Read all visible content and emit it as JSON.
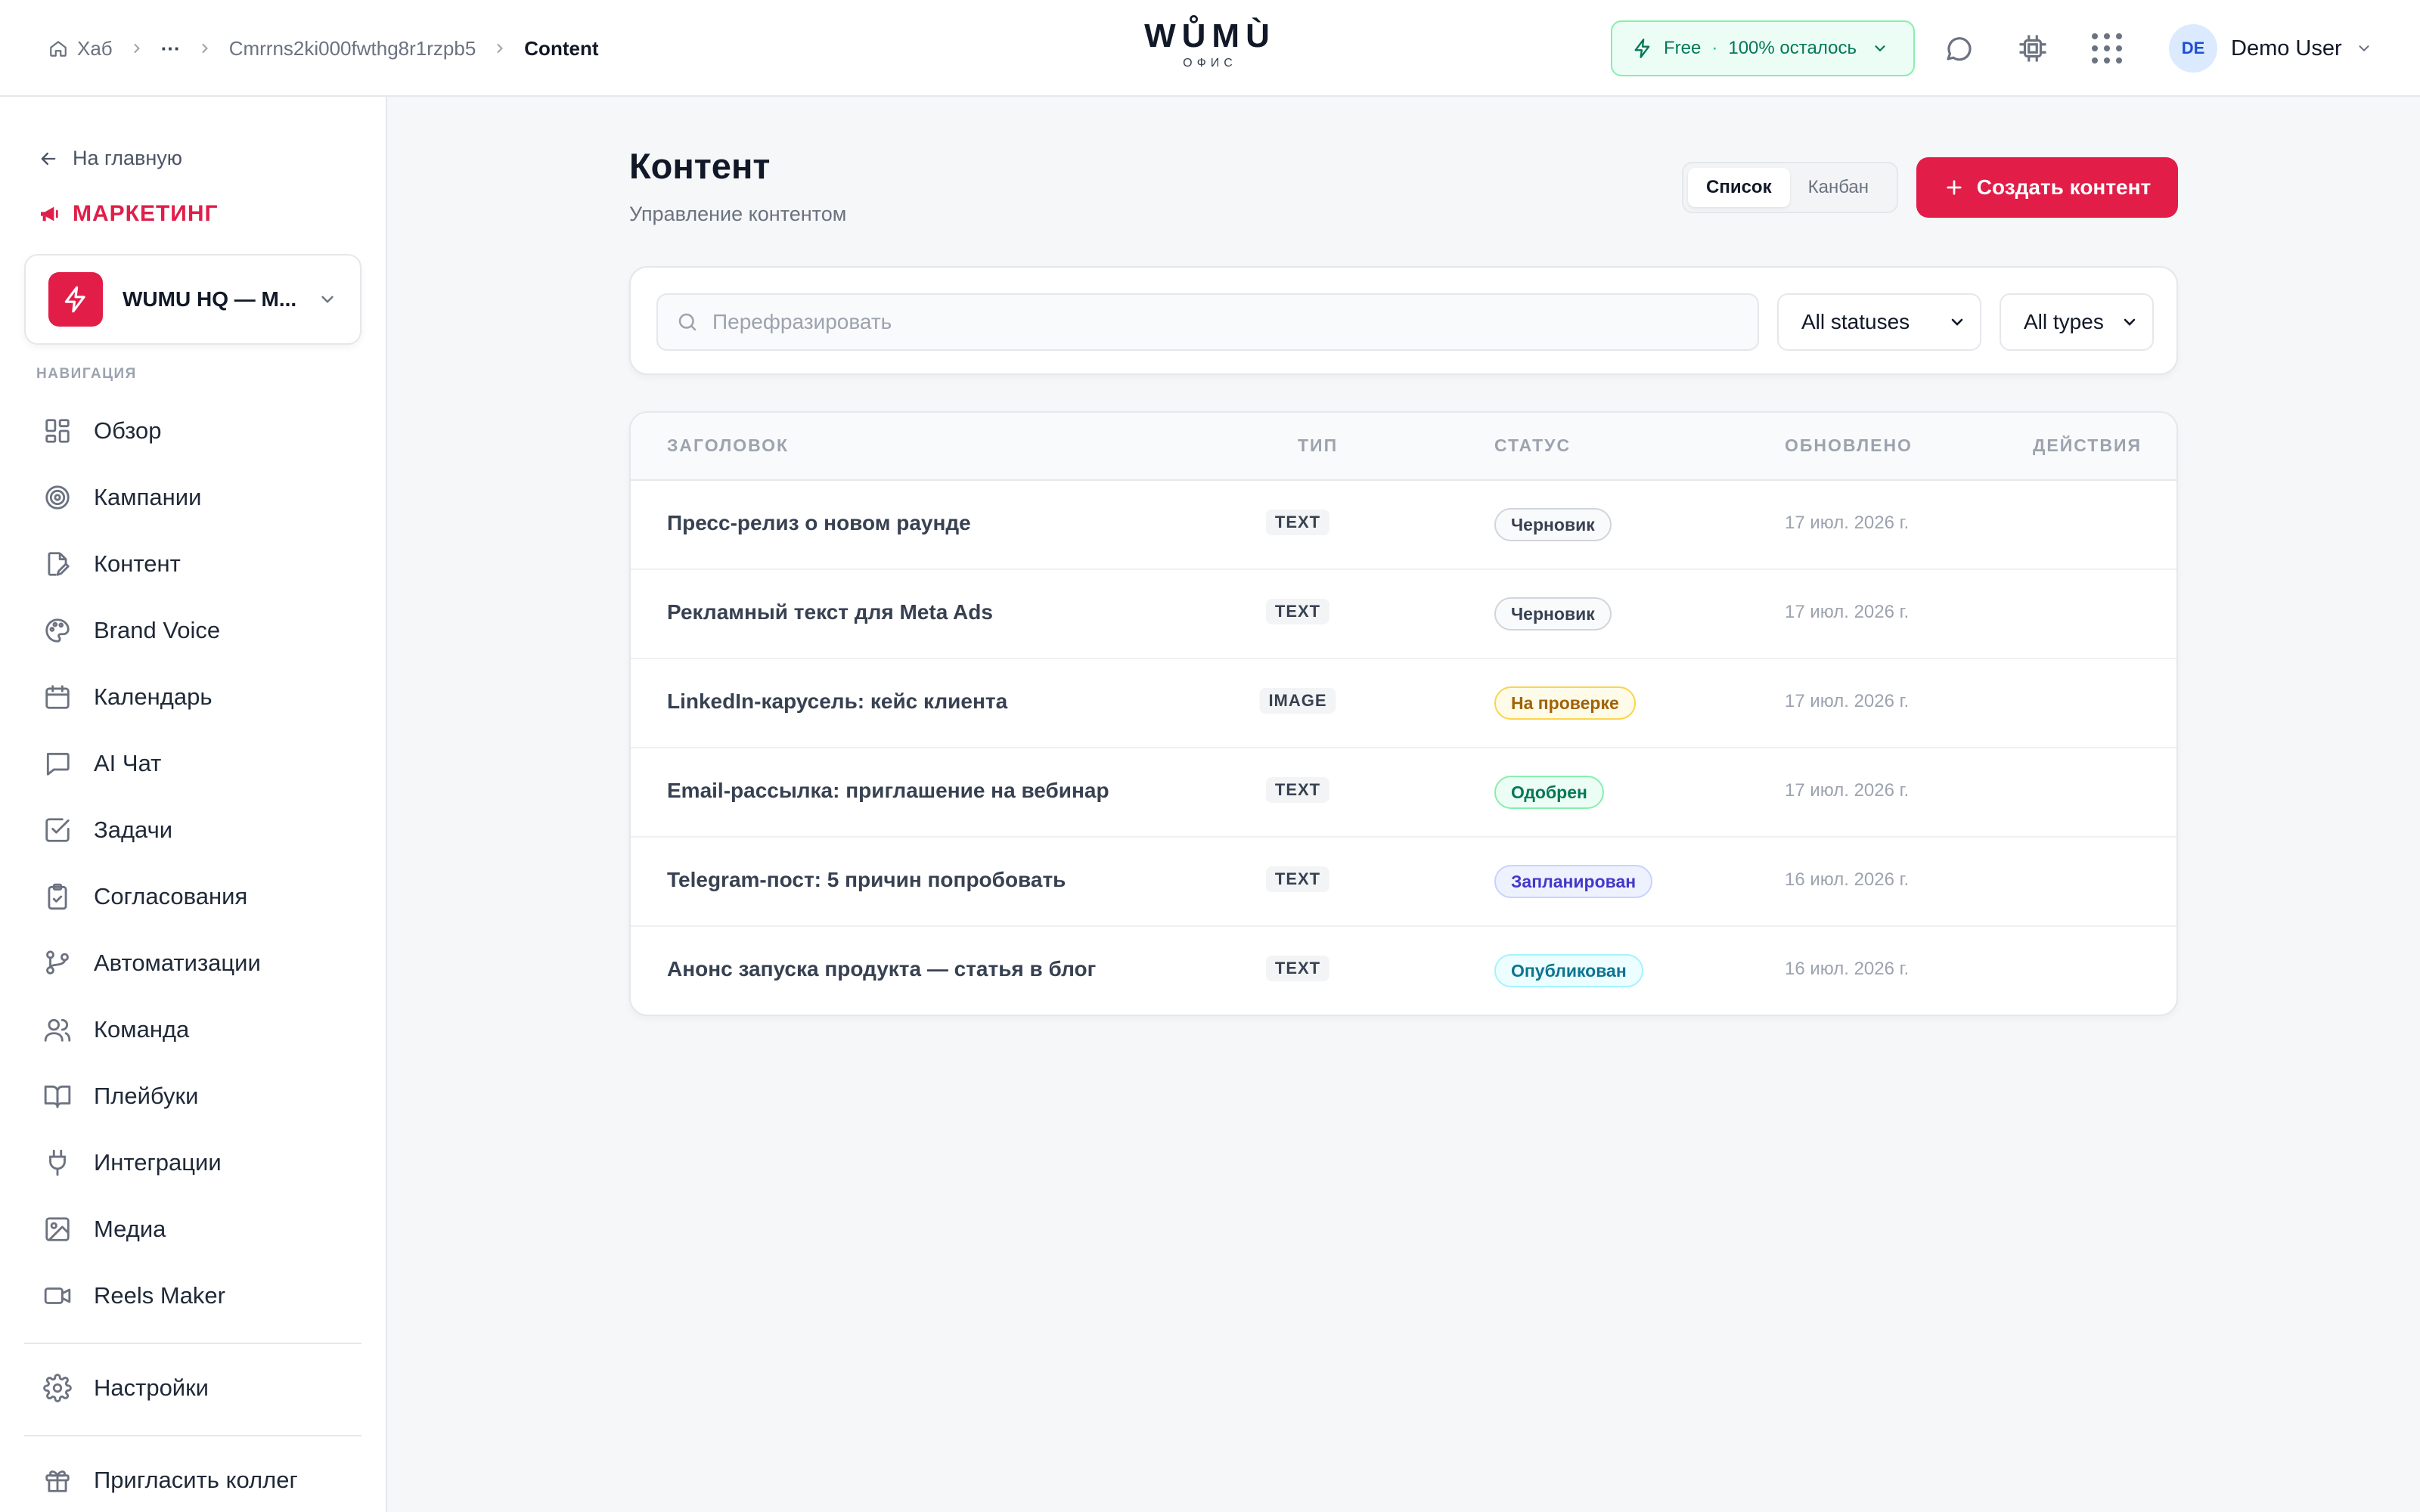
{
  "header": {
    "breadcrumb": [
      "Хаб",
      "···",
      "Cmrrns2ki000fwthg8r1rzpb5",
      "Content"
    ],
    "logo_main": "WŮMÙ",
    "logo_sub": "ОФИС",
    "plan_name": "Free",
    "plan_separator": "·",
    "plan_remaining": "100% осталось",
    "user_initials": "DE",
    "user_name": "Demo User",
    "icons": [
      "home-icon",
      "chat-icon",
      "chip-icon",
      "apps-grid-icon",
      "chevron-down-icon"
    ]
  },
  "sidebar": {
    "back_label": "На главную",
    "section_title": "МАРКЕТИНГ",
    "workspace_name": "WUMU HQ — M...",
    "nav_caption": "НАВИГАЦИЯ",
    "items": [
      {
        "label": "Обзор",
        "icon": "dashboard-icon"
      },
      {
        "label": "Кампании",
        "icon": "target-icon"
      },
      {
        "label": "Контент",
        "icon": "file-edit-icon"
      },
      {
        "label": "Brand Voice",
        "icon": "palette-icon"
      },
      {
        "label": "Календарь",
        "icon": "calendar-icon"
      },
      {
        "label": "AI Чат",
        "icon": "message-icon"
      },
      {
        "label": "Задачи",
        "icon": "checkbox-icon"
      },
      {
        "label": "Согласования",
        "icon": "clipboard-check-icon"
      },
      {
        "label": "Автоматизации",
        "icon": "git-branch-icon"
      },
      {
        "label": "Команда",
        "icon": "users-icon"
      },
      {
        "label": "Плейбуки",
        "icon": "book-icon"
      },
      {
        "label": "Интеграции",
        "icon": "plug-icon"
      },
      {
        "label": "Медиа",
        "icon": "image-icon"
      },
      {
        "label": "Reels Maker",
        "icon": "video-icon"
      }
    ],
    "settings_label": "Настройки",
    "invite_label": "Пригласить коллег"
  },
  "main": {
    "title": "Контент",
    "subtitle": "Управление контентом",
    "view_list": "Список",
    "view_kanban": "Канбан",
    "create_label": "Создать контент",
    "search_placeholder": "Перефразировать",
    "status_filter": "All statuses",
    "type_filter": "All types",
    "columns": {
      "title": "ЗАГОЛОВОК",
      "type": "ТИП",
      "status": "СТАТУС",
      "updated": "ОБНОВЛЕНО",
      "actions": "ДЕЙСТВИЯ"
    },
    "rows": [
      {
        "title": "Пресс-релиз о новом раунде",
        "type": "TEXT",
        "status": "Черновик",
        "status_kind": "draft",
        "updated": "17 июл. 2026 г."
      },
      {
        "title": "Рекламный текст для Meta Ads",
        "type": "TEXT",
        "status": "Черновик",
        "status_kind": "draft",
        "updated": "17 июл. 2026 г."
      },
      {
        "title": "LinkedIn-карусель: кейс клиента",
        "type": "IMAGE",
        "status": "На проверке",
        "status_kind": "review",
        "updated": "17 июл. 2026 г."
      },
      {
        "title": "Email-рассылка: приглашение на вебинар",
        "type": "TEXT",
        "status": "Одобрен",
        "status_kind": "approved",
        "updated": "17 июл. 2026 г."
      },
      {
        "title": "Telegram-пост: 5 причин попробовать",
        "type": "TEXT",
        "status": "Запланирован",
        "status_kind": "scheduled",
        "updated": "16 июл. 2026 г."
      },
      {
        "title": "Анонс запуска продукта — статья в блог",
        "type": "TEXT",
        "status": "Опубликован",
        "status_kind": "published",
        "updated": "16 июл. 2026 г."
      }
    ]
  },
  "colors": {
    "accent": "#e11d48",
    "plan_green": "#047857",
    "status": {
      "draft": {
        "bg": "#f9fafb",
        "border": "#d1d5db",
        "text": "#374151"
      },
      "review": {
        "bg": "#fefce8",
        "border": "#fcd34d",
        "text": "#a16207"
      },
      "approved": {
        "bg": "#ecfdf5",
        "border": "#86efac",
        "text": "#047857"
      },
      "scheduled": {
        "bg": "#eef2ff",
        "border": "#c7d2fe",
        "text": "#4338ca"
      },
      "published": {
        "bg": "#ecfeff",
        "border": "#a5f3fc",
        "text": "#0e7490"
      }
    }
  }
}
